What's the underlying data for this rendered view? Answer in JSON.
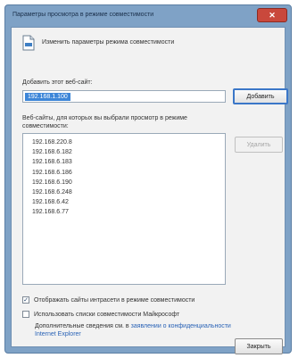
{
  "window": {
    "title": "Параметры просмотра в режиме совместимости",
    "close_glyph": "✕"
  },
  "intro": {
    "text": "Изменить параметры режима совместимости"
  },
  "add_site": {
    "label": "Добавить этот веб-сайт:",
    "value": "192.168.1.100",
    "button_label": "Добавить"
  },
  "sites": {
    "label": "Веб-сайты, для которых вы выбрали просмотр в режиме совместимости:",
    "remove_label": "Удалить",
    "items": [
      "192.168.220.8",
      "192.168.6.182",
      "192.168.6.183",
      "192.168.6.186",
      "192.168.6.190",
      "192.168.6.248",
      "192.168.6.42",
      "192.168.6.77"
    ]
  },
  "options": {
    "intranet": {
      "label": "Отображать сайты интрасети в режиме совместимости",
      "checked": true
    },
    "microsoft_list": {
      "label": "Использовать списки совместимости Майкрософт",
      "checked": false
    }
  },
  "info": {
    "text": "Дополнительные сведения см. в",
    "link": "заявлении о конфиденциальности Internet Explorer"
  },
  "footer": {
    "close_label": "Закрыть"
  }
}
